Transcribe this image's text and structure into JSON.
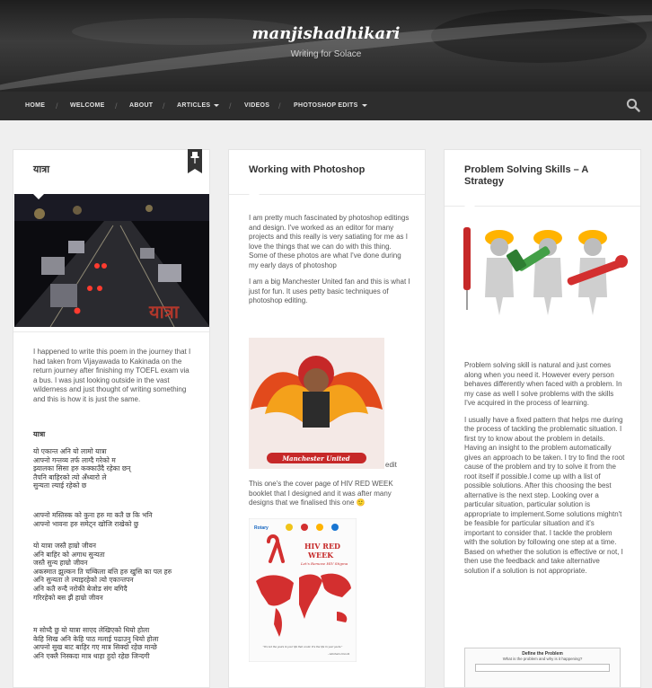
{
  "header": {
    "site_title": "manjishadhikari",
    "tagline": "Writing for Solace"
  },
  "nav": {
    "items": [
      {
        "label": "HOME",
        "dropdown": false
      },
      {
        "label": "WELCOME",
        "dropdown": false
      },
      {
        "label": "ABOUT",
        "dropdown": false
      },
      {
        "label": "ARTICLES",
        "dropdown": true
      },
      {
        "label": "VIDEOS",
        "dropdown": false
      },
      {
        "label": "PHOTOSHOP EDITS",
        "dropdown": true
      }
    ],
    "separator": "/",
    "search_icon": "search-icon"
  },
  "posts": {
    "yatra": {
      "title": "यात्रा",
      "sticky_icon": "pushpin-icon",
      "image_caption": "यात्रा",
      "intro": "I happened to write this poem in the journey that I had taken from Vijayawada to Kakinada on the return journey after finishing my TOEFL exam via a bus. I was just looking outside in the vast wilderness and just thought of writing something and this is how it is just the same.",
      "poem_title": "यात्रा",
      "stanza1": "यो एकान्त अनि यो लामो यात्रा\nआफ्नो गन्तव्य तर्फ लाग्दै गरेको म\nझ्यालका सिसा हरु कक्काउँदै रहेका छन्\nतैपनि बाहिरको त्यो अँध्यारो ले\nसुन्यता ल्याई रहेको छ",
      "stanza2": "आफ्नो मस्तिस्क को कुना हरु मा कतै छ कि भनि\nआफ्नो भावना हरु समेट्न खोजि राखेको छु",
      "stanza3": "यो यात्रा जस्तै हाम्रो जीवन\nअनि बाहिर को अगाध सुन्यता\nजस्तै सुन्य हाम्रो जीवन\nअकस्मात झुल्कन ति चम्किला बत्ति हरु खुसि का पल हरु\nअनि सुन्यता ले ल्याइरहेको त्यो एकान्तपन\nअनि कतै रुन्दै नरोकी बेजोड संग बगिदै\nगरिरहेको बस झैं हाम्रो जीवन",
      "stanza4": "म सोच्दै छु यो यात्रा साएद लेखिएको थियो होला\nकेहि सिख अनि केहि पाठ मलाई पढाउनु थियो होला\nआफ्नो सुख बाट बाहिर गए मात्र सिक्दो रहेछ मान्छे\nअनि एक्लै निस्कदा मात्र थाहा हुदो रहेछ जिन्दगी"
    },
    "photoshop": {
      "title": "Working with Photoshop",
      "p1": "I am pretty much fascinated by photoshop editings and design. I've worked as an editor for many projects and this really is very satiating for me as I love the things that we can do with this thing. Some of these photos are what I've done during my early days of photoshop",
      "p2": "I am a big Manchester United fan and this is what I just for fun. It uses petty basic techniques of photoshop editing.",
      "image1_caption": "Manchester United",
      "edit_link": "edit",
      "p3": "This one's the cover page of HIV RED WEEK booklet that I designed and it was after many designs that we finalised this one",
      "smiley": "🙂",
      "poster": {
        "logo_left": "Rotary",
        "heading1": "HIV RED",
        "heading2": "WEEK",
        "slogan": "Let's Remove HIV Stigma",
        "quote": "\"It's not the years in your life that count. It's the life in your years.\"",
        "attribution": "- Abraham Lincoln"
      }
    },
    "problem": {
      "title": "Problem Solving Skills – A Strategy",
      "p1": "Problem solving skill is natural and just comes along when you need it. However every person behaves differently when faced with a problem. In my case as well I solve problems with the skills I've acquired in the process of learning.",
      "p2": "I usually have a fixed pattern that helps me during the process of tackling the problematic situation. I first try to know about the problem in details. Having an insight to the problem automatically gives an approach to be taken. I try to find the root cause of the problem and try to solve it from the root itself if possible.I come up with a list of possible solutions. After this choosing the best alternative is the next step. Looking over a particular situation, particular solution is appropriate to implement.Some solutions mightn't be feasible for particular situation and it's important to consider that. I tackle the problem with the solution by following one step at a time. Based on whether the solution is effective or not, I then use the feedback and take alternative solution if a solution is not appropriate.",
      "diagram_title": "Define the Problem",
      "diagram_sub": "What is the problem and why is it happening?"
    }
  }
}
